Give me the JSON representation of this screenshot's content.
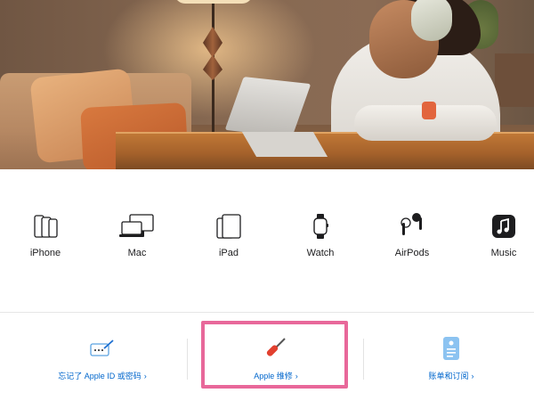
{
  "products": [
    {
      "label": "iPhone",
      "icon": "iphone-icon"
    },
    {
      "label": "Mac",
      "icon": "mac-icon"
    },
    {
      "label": "iPad",
      "icon": "ipad-icon"
    },
    {
      "label": "Watch",
      "icon": "watch-icon"
    },
    {
      "label": "AirPods",
      "icon": "airpods-icon"
    },
    {
      "label": "Music",
      "icon": "music-icon"
    }
  ],
  "help_cards": [
    {
      "label": "忘记了 Apple ID 或密码",
      "icon": "keyboard-pencil-icon"
    },
    {
      "label": "Apple 维修",
      "icon": "screwdriver-icon"
    },
    {
      "label": "账单和订阅",
      "icon": "billing-document-icon"
    }
  ],
  "chevron": "›",
  "colors": {
    "link": "#0066cc",
    "highlight": "#e8689a",
    "text": "#1d1d1f"
  }
}
